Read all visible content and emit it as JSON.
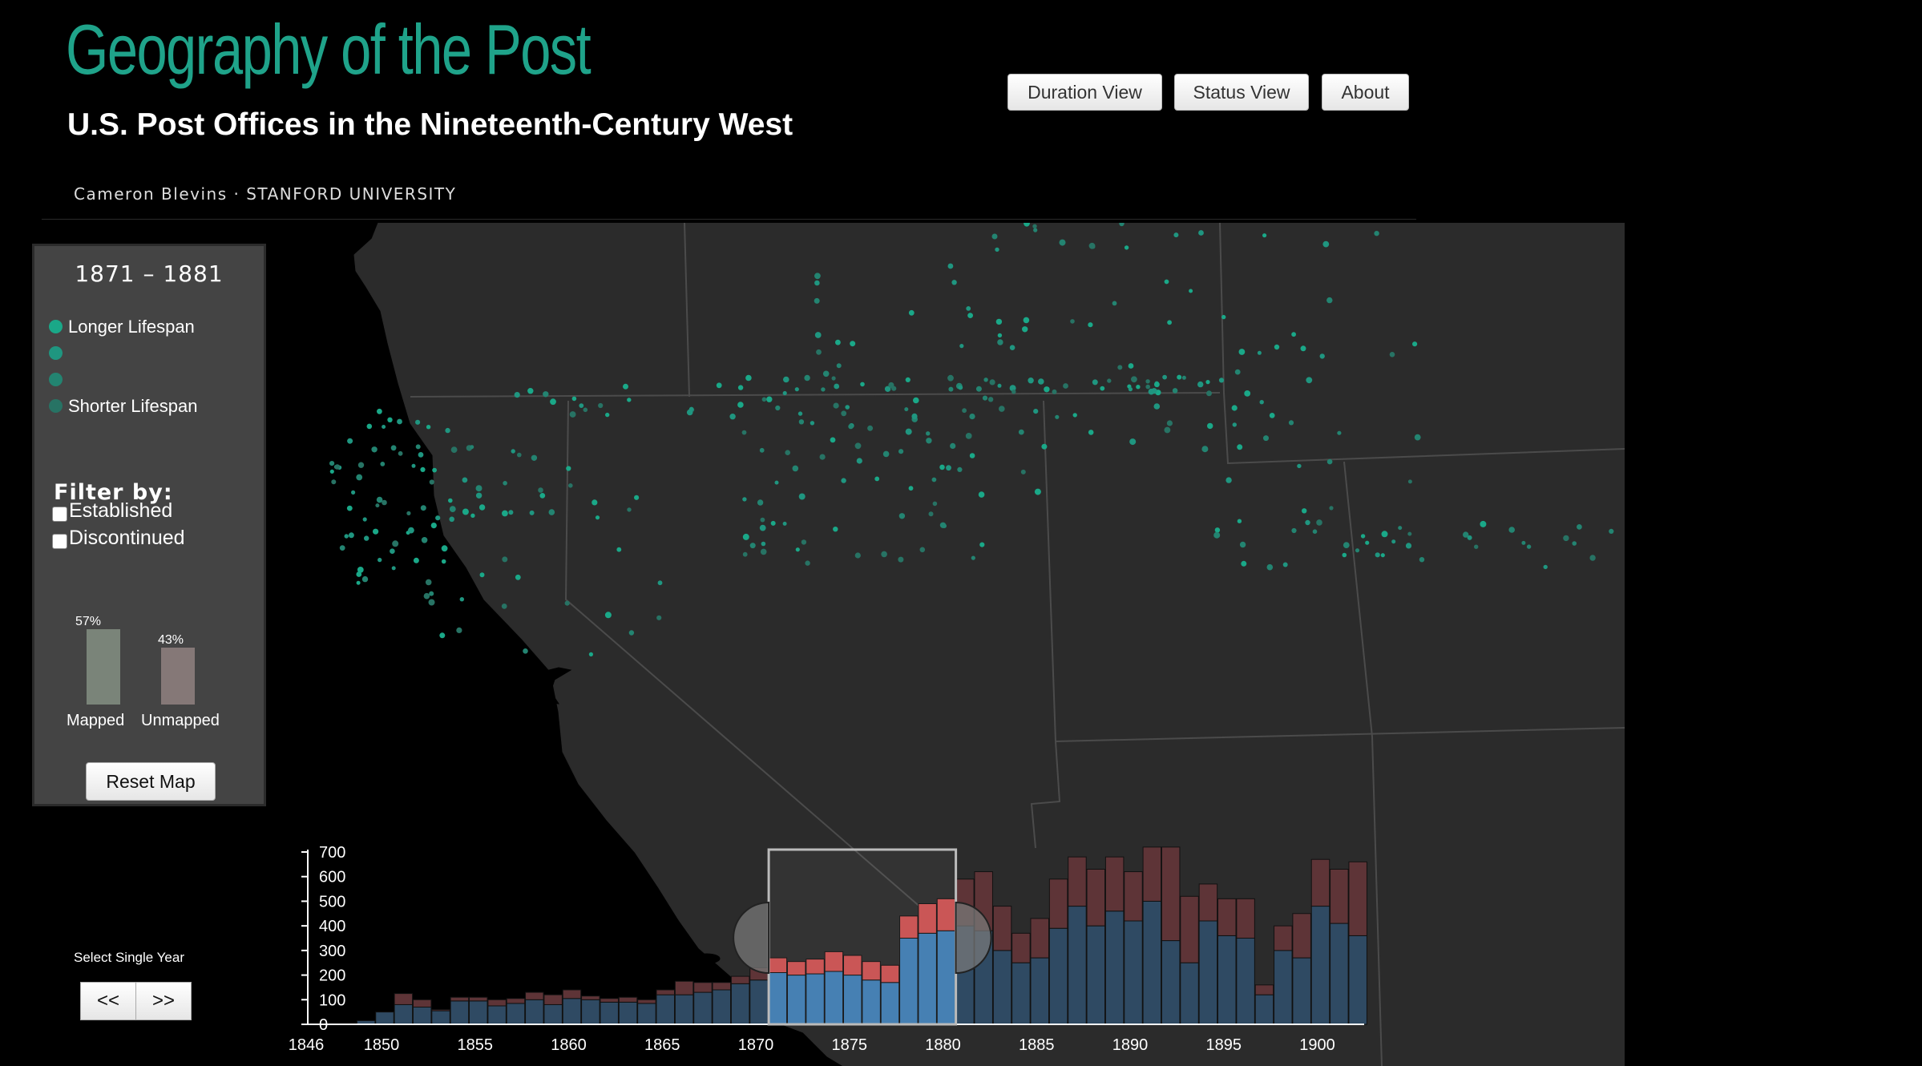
{
  "header": {
    "title": "Geography of the Post",
    "subtitle": "U.S. Post Offices in the Nineteenth-Century West",
    "byline": "Cameron Blevins  ·  STANFORD UNIVERSITY"
  },
  "nav": [
    {
      "label": "Duration View"
    },
    {
      "label": "Status View"
    },
    {
      "label": "About"
    }
  ],
  "panel": {
    "range": "1871 – 1881",
    "legend": [
      {
        "label": "Longer Lifespan",
        "color": "#1aa888"
      },
      {
        "label": "",
        "color": "#1f9680"
      },
      {
        "label": "",
        "color": "#238471"
      },
      {
        "label": "Shorter Lifespan",
        "color": "#277364"
      }
    ],
    "filter_title": "Filter by:",
    "filters": [
      {
        "label": "Established",
        "checked": false
      },
      {
        "label": "Discontinued",
        "checked": false
      }
    ],
    "mapped": {
      "label": "Mapped",
      "percent": "57%",
      "value": 57,
      "color": "#7a8479"
    },
    "unmapped": {
      "label": "Unmapped",
      "percent": "43%",
      "value": 43,
      "color": "#857877"
    },
    "reset_label": "Reset Map"
  },
  "single_year": {
    "label": "Select Single Year",
    "prev": "<<",
    "next": ">>"
  },
  "colors": {
    "accent": "#1fa38a",
    "established": "#3f7bb0",
    "discontinued": "#c85050",
    "map_land": "#2b2b2b",
    "map_border": "#555555"
  },
  "chart_data": {
    "type": "bar",
    "stacked": true,
    "selection": [
      1871,
      1881
    ],
    "x_ticks": [
      "1846",
      "1850",
      "1855",
      "1860",
      "1865",
      "1870",
      "1875",
      "1880",
      "1885",
      "1890",
      "1895",
      "1900"
    ],
    "y_ticks": [
      "0",
      "100",
      "200",
      "300",
      "400",
      "500",
      "600",
      "700"
    ],
    "ylim": [
      0,
      700
    ],
    "years": [
      1849,
      1850,
      1851,
      1852,
      1853,
      1854,
      1855,
      1856,
      1857,
      1858,
      1859,
      1860,
      1861,
      1862,
      1863,
      1864,
      1865,
      1866,
      1867,
      1868,
      1869,
      1870,
      1871,
      1872,
      1873,
      1874,
      1875,
      1876,
      1877,
      1878,
      1879,
      1880,
      1881,
      1882,
      1883,
      1884,
      1885,
      1886,
      1887,
      1888,
      1889,
      1890,
      1891,
      1892,
      1893,
      1894,
      1895,
      1896,
      1897,
      1898,
      1899,
      1900,
      1901,
      1902
    ],
    "series": [
      {
        "name": "Established",
        "values": [
          15,
          50,
          80,
          70,
          55,
          95,
          95,
          75,
          85,
          100,
          80,
          105,
          100,
          90,
          90,
          85,
          120,
          120,
          130,
          140,
          165,
          180,
          210,
          200,
          205,
          215,
          200,
          180,
          170,
          350,
          370,
          380,
          400,
          380,
          300,
          250,
          270,
          390,
          480,
          400,
          460,
          420,
          500,
          340,
          250,
          420,
          360,
          350,
          120,
          300,
          270,
          480,
          410,
          360
        ]
      },
      {
        "name": "Discontinued",
        "values": [
          0,
          0,
          45,
          30,
          5,
          15,
          15,
          25,
          20,
          30,
          40,
          35,
          15,
          15,
          20,
          15,
          20,
          55,
          40,
          30,
          30,
          50,
          60,
          55,
          60,
          80,
          80,
          75,
          70,
          90,
          120,
          130,
          190,
          240,
          180,
          120,
          160,
          200,
          200,
          230,
          220,
          200,
          220,
          380,
          270,
          150,
          150,
          160,
          40,
          100,
          180,
          190,
          220,
          300
        ]
      }
    ]
  }
}
